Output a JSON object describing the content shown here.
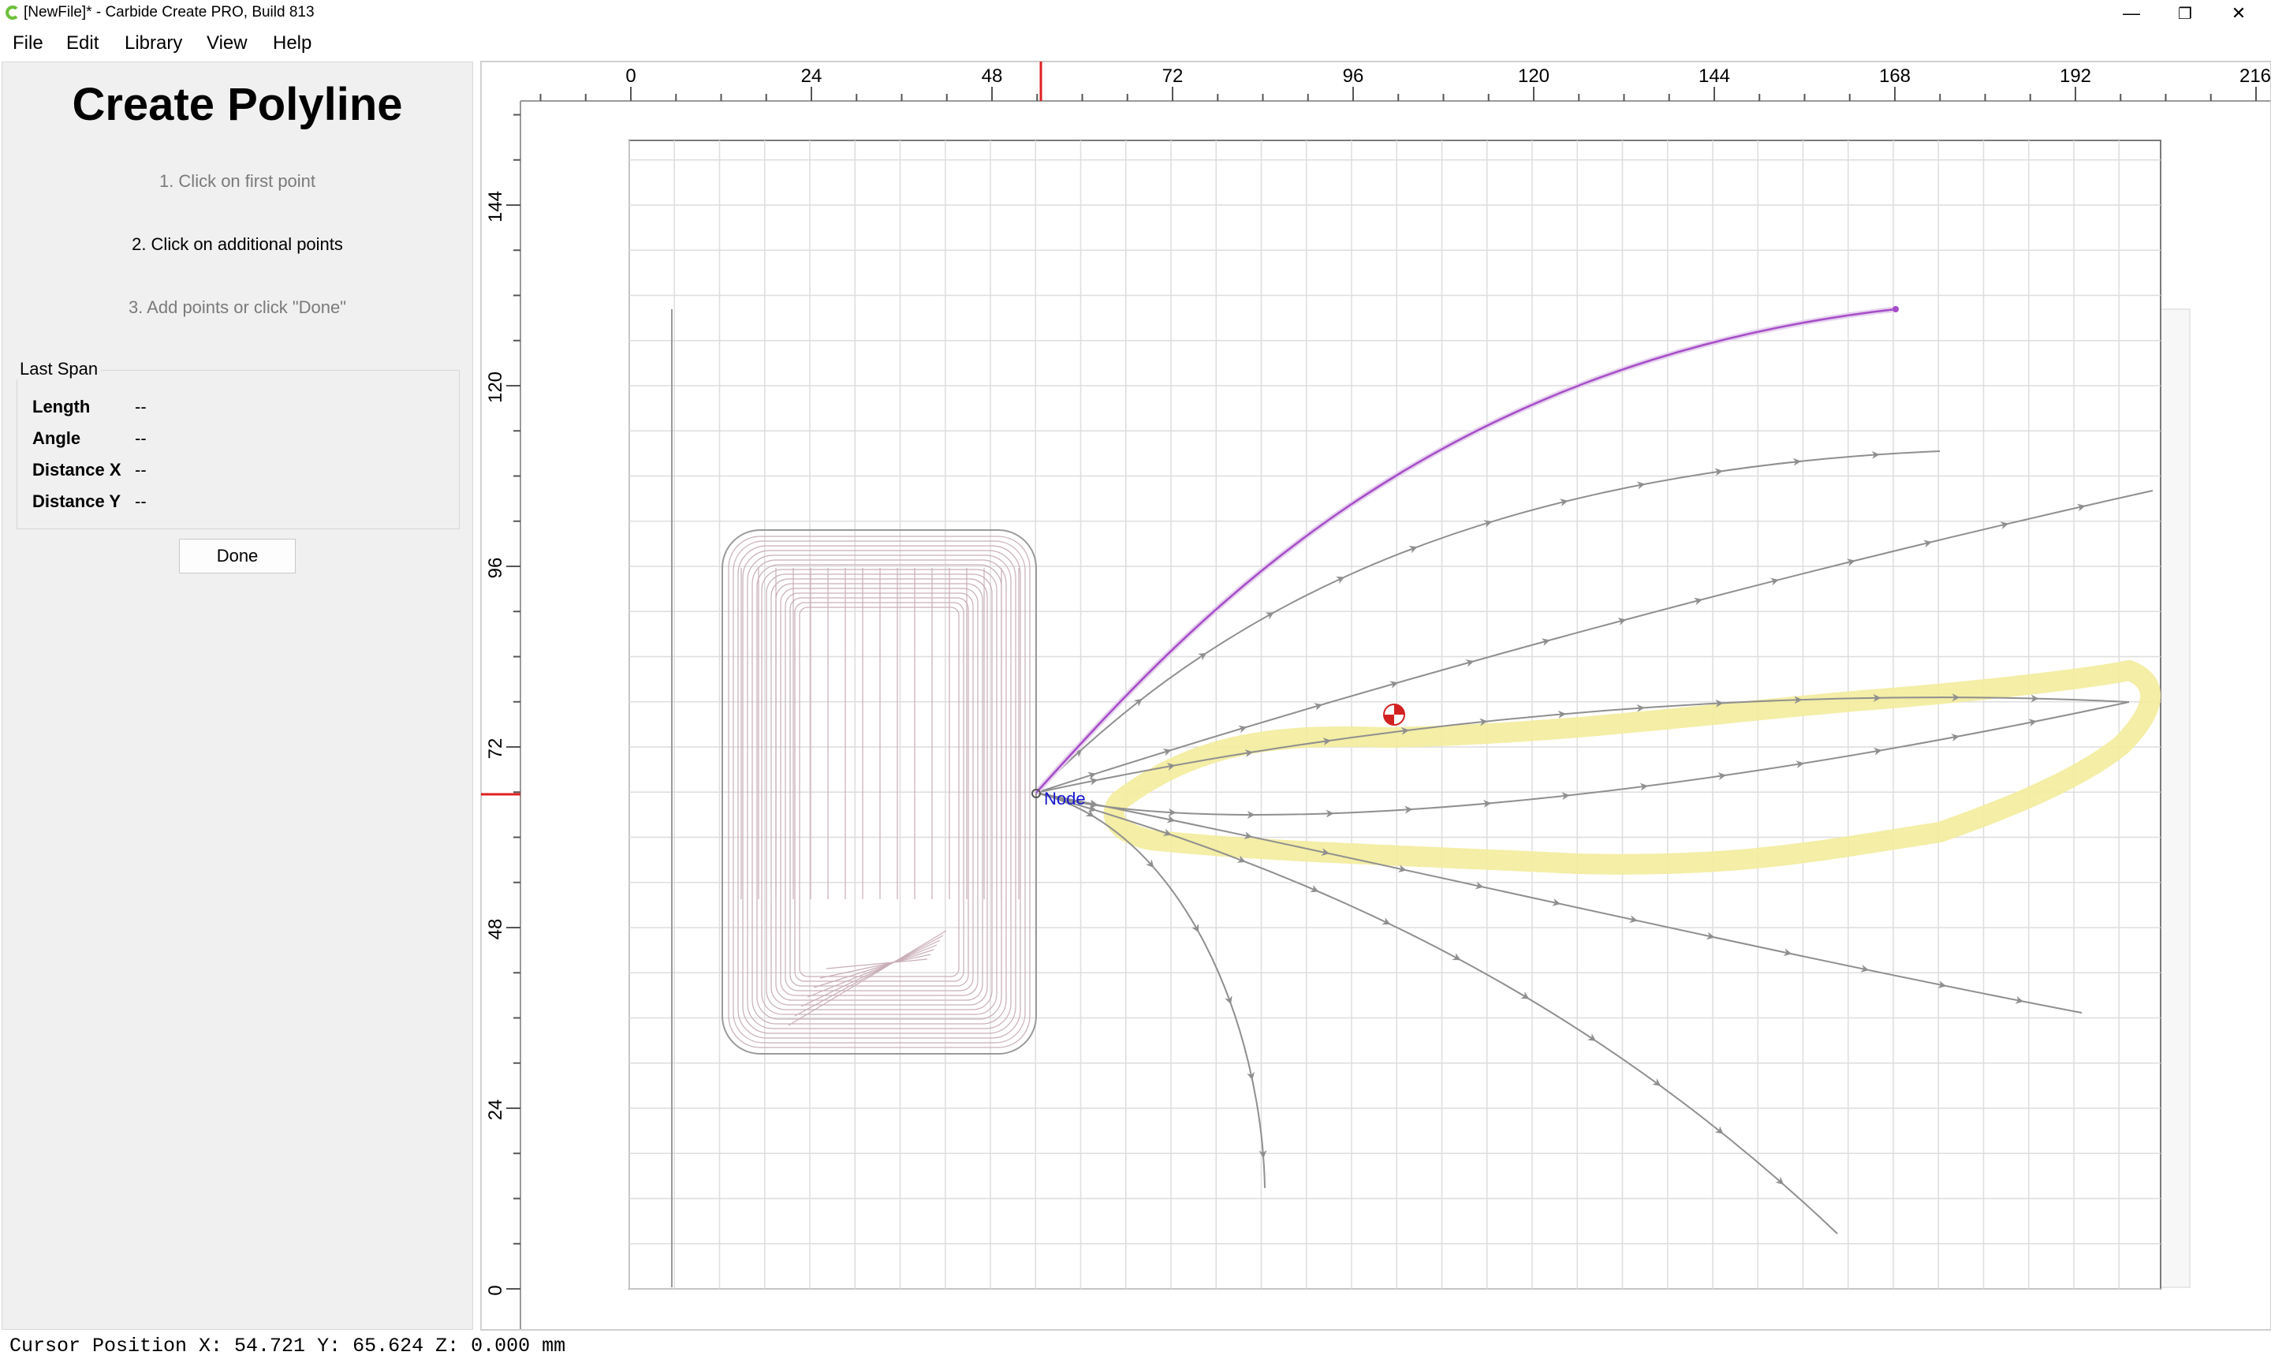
{
  "window": {
    "title": "[NewFile]* - Carbide Create PRO, Build 813",
    "minimize_glyph": "—",
    "restore_glyph": "❐",
    "close_glyph": "✕"
  },
  "menu": {
    "items": [
      "File",
      "Edit",
      "Library",
      "View",
      "Help"
    ]
  },
  "panel": {
    "title": "Create Polyline",
    "steps": [
      "1. Click on first point",
      "2. Click on additional points",
      "3. Add points or click \"Done\""
    ],
    "active_step": 2,
    "last_span": {
      "title": "Last Span",
      "rows": [
        {
          "label": "Length",
          "value": "--"
        },
        {
          "label": "Angle",
          "value": "--"
        },
        {
          "label": "Distance X",
          "value": "--"
        },
        {
          "label": "Distance Y",
          "value": "--"
        }
      ]
    },
    "done_label": "Done"
  },
  "ruler": {
    "x_labels": [
      "0",
      "24",
      "48",
      "72",
      "96",
      "120",
      "144",
      "168",
      "192",
      "216"
    ],
    "y_labels": [
      "144",
      "120",
      "96",
      "72",
      "48",
      "24",
      "0"
    ]
  },
  "canvas": {
    "node_label": "Node",
    "colors": {
      "toolpath": "#8f8f8f",
      "polyline": "#a64cc8",
      "highlight": "#f3ec9c",
      "ruler_marker": "#e02020",
      "node_text": "#1515d0",
      "origin_marker": "#d22020",
      "pocket": "#c9aeb8"
    }
  },
  "status": {
    "text": "Cursor Position X: 54.721 Y: 65.624 Z: 0.000 mm"
  }
}
